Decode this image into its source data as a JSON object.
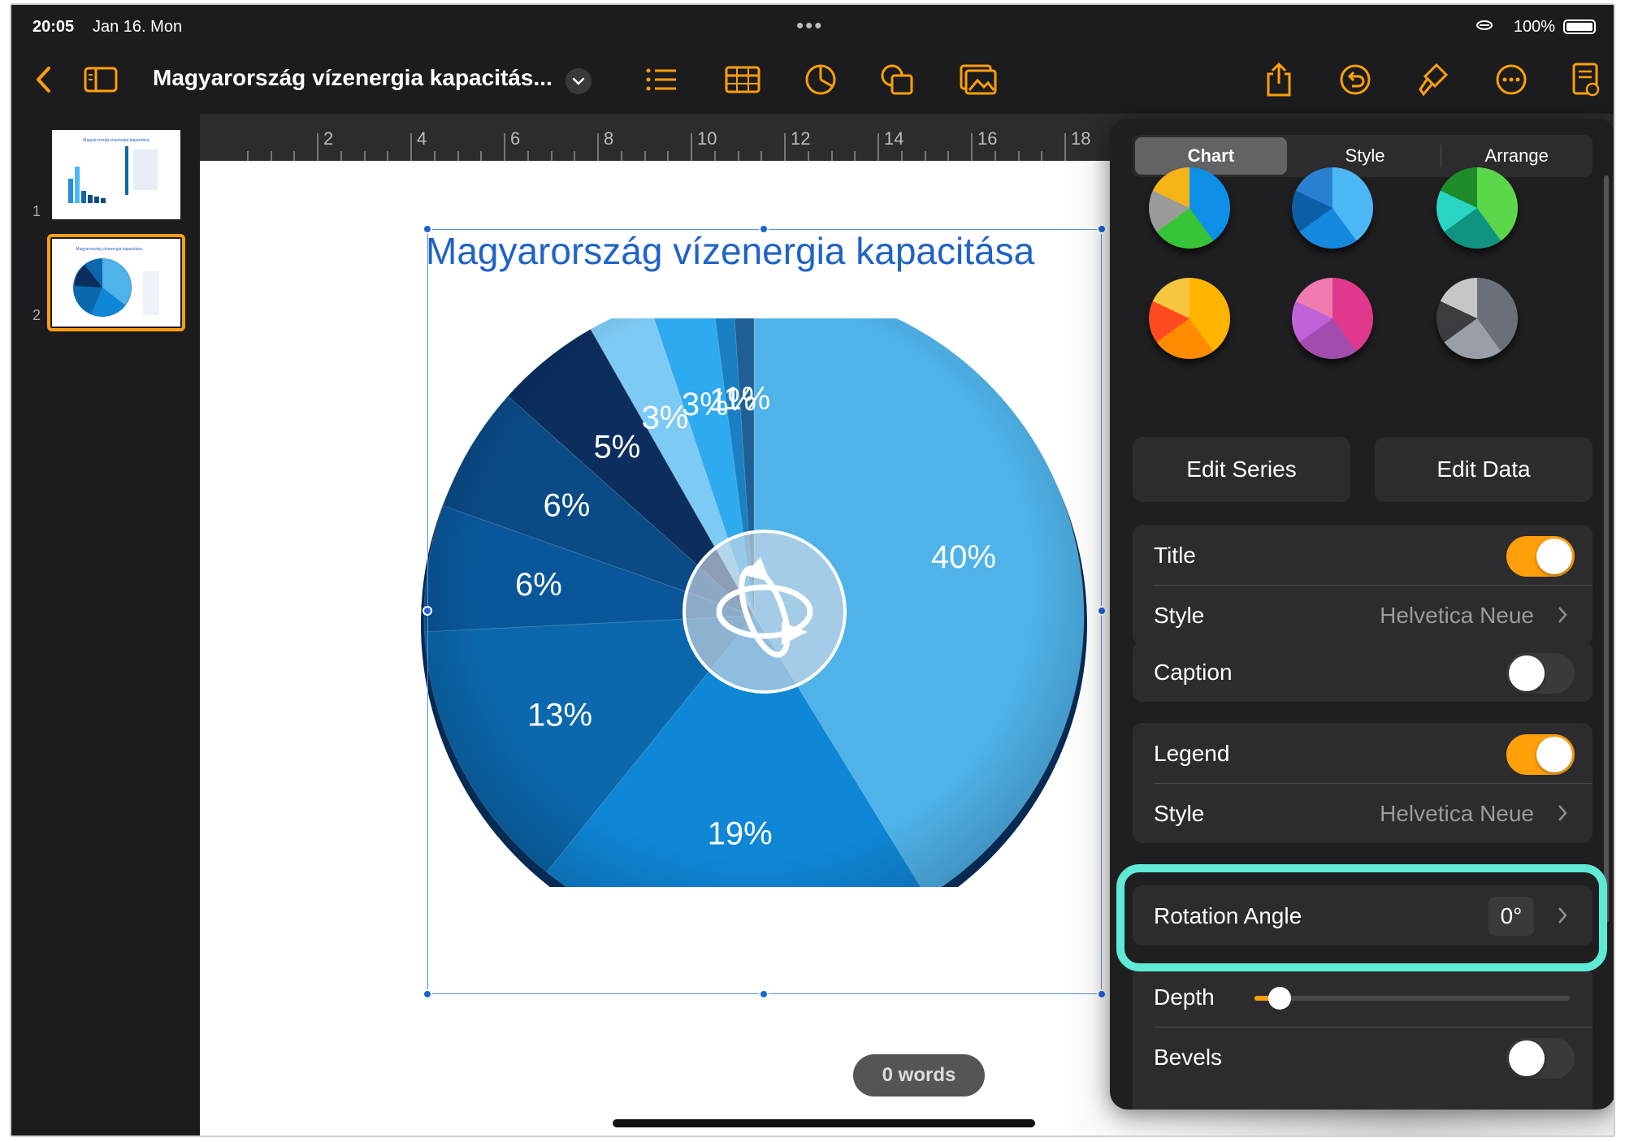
{
  "status": {
    "time": "20:05",
    "date": "Jan 16. Mon",
    "battery": "100%"
  },
  "toolbar": {
    "doc_title": "Magyarország vízenergia kapacitás..."
  },
  "sidebar": {
    "slides": [
      {
        "number": "1"
      },
      {
        "number": "2",
        "selected": true
      }
    ]
  },
  "ruler": {
    "labels": [
      "2",
      "4",
      "6",
      "8",
      "10",
      "12",
      "14",
      "16",
      "18"
    ]
  },
  "canvas": {
    "word_count": "0 words"
  },
  "chart_data": {
    "type": "pie",
    "title": "Magyarország vízenergia kapacitása",
    "values": [
      40,
      19,
      13,
      6,
      6,
      5,
      3,
      3,
      1,
      1
    ],
    "labels": [
      "40%",
      "19%",
      "13%",
      "6%",
      "6%",
      "5%",
      "3%",
      "3%",
      "1%",
      "1%"
    ],
    "colors": [
      "#4fb3ea",
      "#0f86d6",
      "#0b68ad",
      "#09579a",
      "#0a4a85",
      "#0b2e5e",
      "#7dcbf5",
      "#2eaaf0",
      "#1a80c4",
      "#1f5f93"
    ],
    "style": "3D",
    "rotation_angle_deg": 0
  },
  "inspector": {
    "tabs": [
      "Chart",
      "Style",
      "Arrange"
    ],
    "active_tab": "Chart",
    "color_swatches": [
      {
        "name": "multicolor-green-blue",
        "colors": [
          "#0e8fe8",
          "#37c437",
          "#9a9a9a",
          "#f5b318"
        ]
      },
      {
        "name": "blues",
        "colors": [
          "#4cb7f5",
          "#1689de",
          "#0a5fa5",
          "#2a7fd0"
        ]
      },
      {
        "name": "greens-teal",
        "colors": [
          "#5ad84a",
          "#109480",
          "#2ad4c4",
          "#1f8c2c"
        ]
      },
      {
        "name": "warm-orange",
        "colors": [
          "#ffb400",
          "#ff8c00",
          "#ff4b1f",
          "#f7c640"
        ]
      },
      {
        "name": "pink-purple",
        "colors": [
          "#e0388c",
          "#a44bb0",
          "#c062d8",
          "#f07bb0"
        ]
      },
      {
        "name": "grays",
        "colors": [
          "#6b7078",
          "#9a9ea6",
          "#3a3c40",
          "#c4c6ca"
        ]
      }
    ],
    "edit_series_label": "Edit Series",
    "edit_data_label": "Edit Data",
    "title_label": "Title",
    "title_on": true,
    "title_style_label": "Style",
    "title_style_value": "Helvetica Neue",
    "caption_label": "Caption",
    "caption_on": false,
    "legend_label": "Legend",
    "legend_on": true,
    "legend_style_label": "Style",
    "legend_style_value": "Helvetica Neue",
    "rotation_label": "Rotation Angle",
    "rotation_value": "0°",
    "depth_label": "Depth",
    "depth_value": 0.08,
    "bevels_label": "Bevels",
    "bevels_on": false
  },
  "colors": {
    "accent": "#ff9f0a",
    "highlight": "#5eead4",
    "title_blue": "#1f63c7"
  }
}
